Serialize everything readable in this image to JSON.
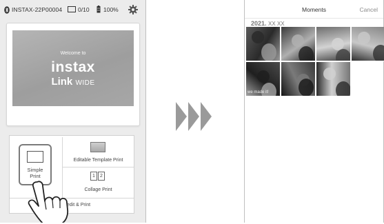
{
  "left_phone": {
    "status": {
      "device_name": "INSTAX-22P00004",
      "film_count": "0/10",
      "battery": "100%",
      "icons": [
        "bluetooth-icon",
        "film-icon",
        "battery-icon",
        "gear-icon"
      ]
    },
    "banner": {
      "welcome": "Welcome to",
      "brand_line1": "instax",
      "brand_line2": "Link",
      "brand_line2_suffix": "WIDE"
    },
    "menu": {
      "simple_print_line1": "Simple",
      "simple_print_line2": "Print",
      "editable_template": "Editable Template Print",
      "collage": "Collage Print",
      "collage_cells": [
        "1",
        "2"
      ],
      "edit_print": "edit & Print"
    }
  },
  "right_phone": {
    "title": "Moments",
    "cancel": "Cancel",
    "date": "2021.",
    "date_suffix": "XX  XX",
    "photos": [
      {
        "tones": [
          "#5a5a5a",
          "#2a2a2a",
          "#9a9a9a"
        ],
        "caption": ""
      },
      {
        "tones": [
          "#3b3b3b",
          "#b0b0b0",
          "#1e1e1e"
        ],
        "caption": ""
      },
      {
        "tones": [
          "#6e6e6e",
          "#d3d3d3",
          "#404040"
        ],
        "caption": ""
      },
      {
        "tones": [
          "#888888",
          "#c8c8c8",
          "#2f2f2f"
        ],
        "caption": ""
      },
      {
        "tones": [
          "#4b4b4b",
          "#1f1f1f",
          "#a5a5a5"
        ],
        "caption": "we made it!"
      },
      {
        "tones": [
          "#3a3a3a",
          "#7a7a7a",
          "#151515"
        ],
        "caption": ""
      },
      {
        "tones": [
          "#777777",
          "#d0d0d0",
          "#2b2b2b"
        ],
        "caption": ""
      }
    ]
  },
  "colors": {
    "left_background": "#ececec",
    "banner_gray": "#a8a8a8",
    "arrow_gray": "#9a9a9a",
    "highlight_border": "#7a7a7a"
  }
}
